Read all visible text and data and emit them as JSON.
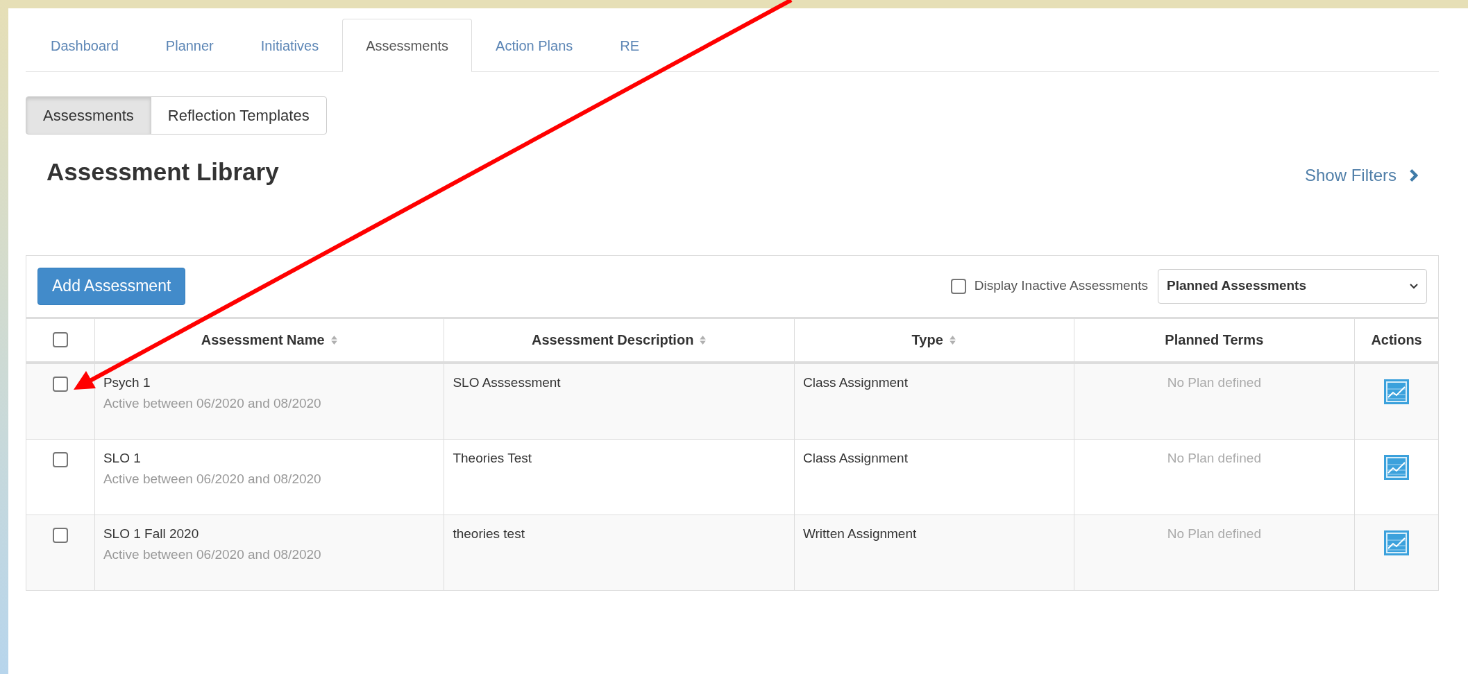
{
  "tabs": [
    {
      "label": "Dashboard",
      "selected": false
    },
    {
      "label": "Planner",
      "selected": false
    },
    {
      "label": "Initiatives",
      "selected": false
    },
    {
      "label": "Assessments",
      "selected": true
    },
    {
      "label": "Action Plans",
      "selected": false
    },
    {
      "label": "RE",
      "selected": false
    }
  ],
  "subtabs": [
    {
      "label": "Assessments",
      "selected": true
    },
    {
      "label": "Reflection Templates",
      "selected": false
    }
  ],
  "heading": "Assessment Library",
  "show_filters": "Show Filters",
  "toolbar": {
    "add_button": "Add Assessment",
    "inactive_checkbox": {
      "label": "Display Inactive Assessments",
      "checked": false
    },
    "select": "Planned Assessments"
  },
  "table": {
    "select_all_checked": false,
    "columns": [
      {
        "label": "Assessment Name",
        "sortable": true
      },
      {
        "label": "Assessment Description",
        "sortable": true
      },
      {
        "label": "Type",
        "sortable": true
      },
      {
        "label": "Planned Terms",
        "sortable": false
      },
      {
        "label": "Actions",
        "sortable": false
      }
    ],
    "rows": [
      {
        "checked": false,
        "name": "Psych 1",
        "active": "Active between 06/2020 and 08/2020",
        "description": "SLO Asssessment",
        "type": "Class Assignment",
        "planned_terms": "No Plan defined"
      },
      {
        "checked": false,
        "name": "SLO 1",
        "active": "Active between 06/2020 and 08/2020",
        "description": "Theories Test",
        "type": "Class Assignment",
        "planned_terms": "No Plan defined"
      },
      {
        "checked": false,
        "name": "SLO 1 Fall 2020",
        "active": "Active between 06/2020 and 08/2020",
        "description": "theories test",
        "type": "Written Assignment",
        "planned_terms": "No Plan defined"
      }
    ]
  },
  "annotation": {
    "kind": "arrow"
  }
}
